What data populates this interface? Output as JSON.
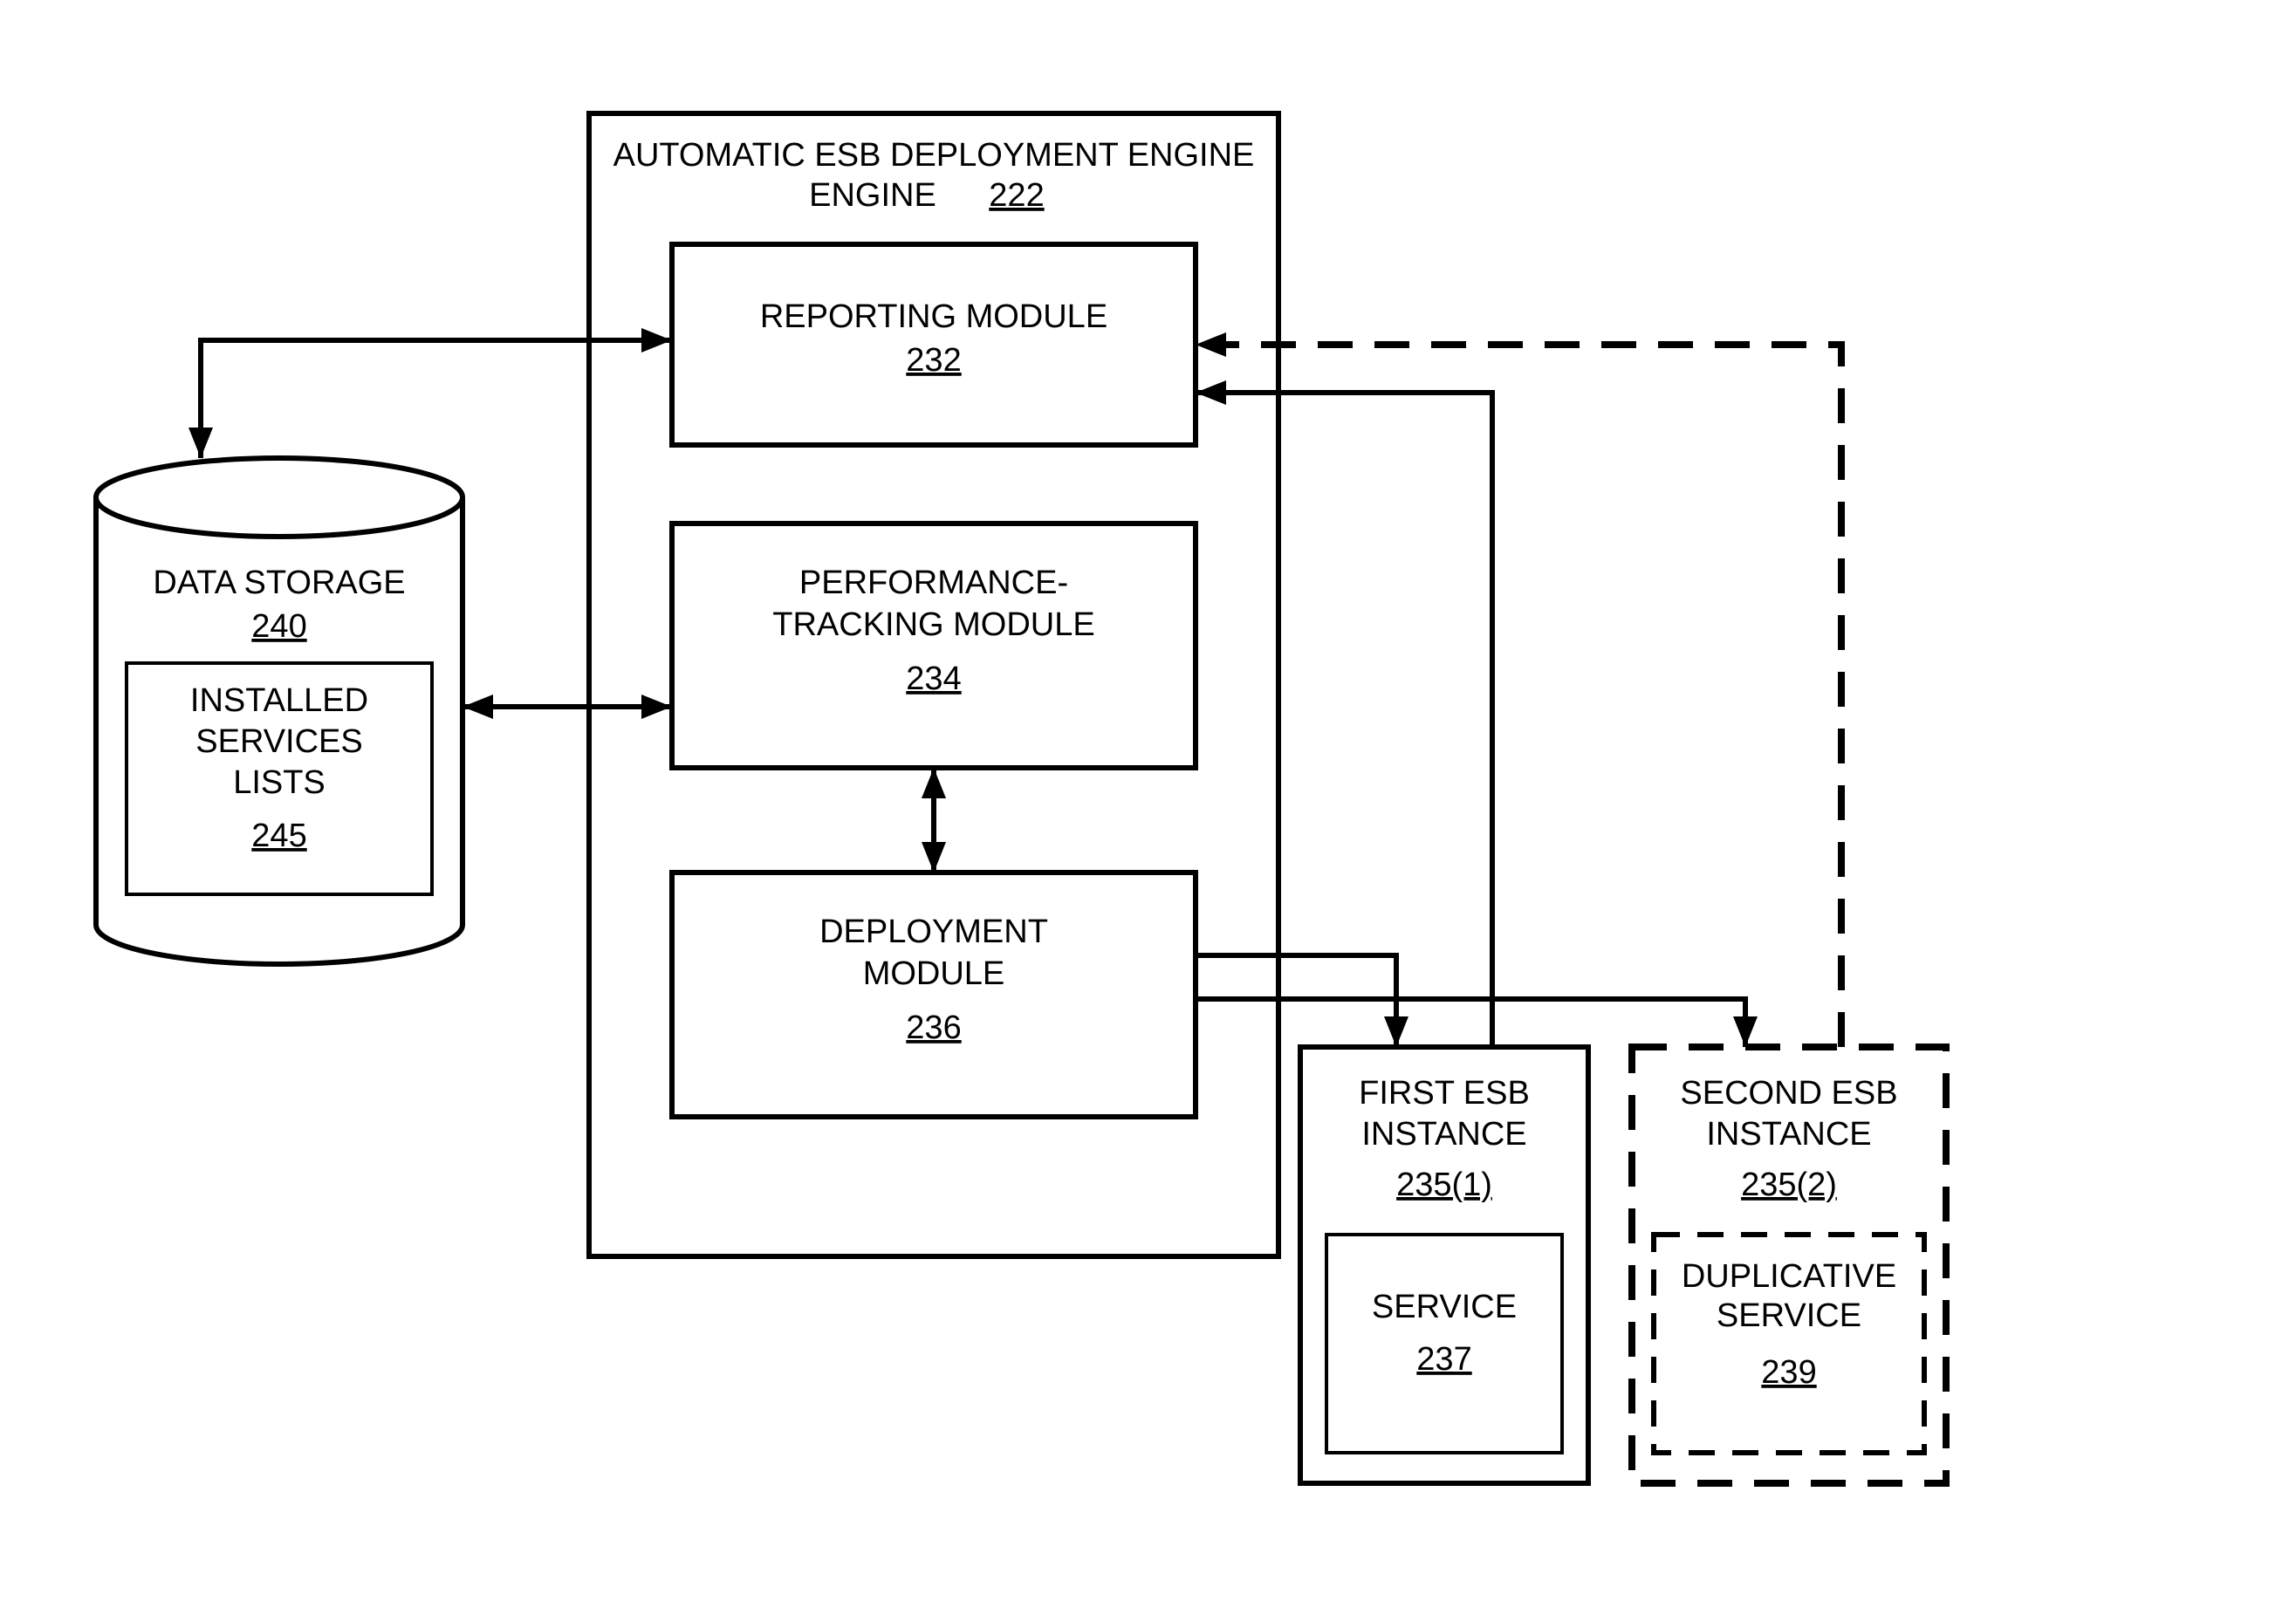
{
  "engine": {
    "title": "AUTOMATIC ESB DEPLOYMENT ENGINE",
    "ref": "222",
    "reporting": {
      "title": "REPORTING MODULE",
      "ref": "232"
    },
    "tracking": {
      "title1": "PERFORMANCE-",
      "title2": "TRACKING MODULE",
      "ref": "234"
    },
    "deployment": {
      "title1": "DEPLOYMENT",
      "title2": "MODULE",
      "ref": "236"
    }
  },
  "storage": {
    "title": "DATA STORAGE",
    "ref": "240",
    "lists": {
      "t1": "INSTALLED",
      "t2": "SERVICES",
      "t3": "LISTS",
      "ref": "245"
    }
  },
  "esb1": {
    "title1": "FIRST ESB",
    "title2": "INSTANCE",
    "ref": "235(1)",
    "service": {
      "title": "SERVICE",
      "ref": "237"
    }
  },
  "esb2": {
    "title1": "SECOND ESB",
    "title2": "INSTANCE",
    "ref": "235(2)",
    "service": {
      "t1": "DUPLICATIVE",
      "t2": "SERVICE",
      "ref": "239"
    }
  }
}
